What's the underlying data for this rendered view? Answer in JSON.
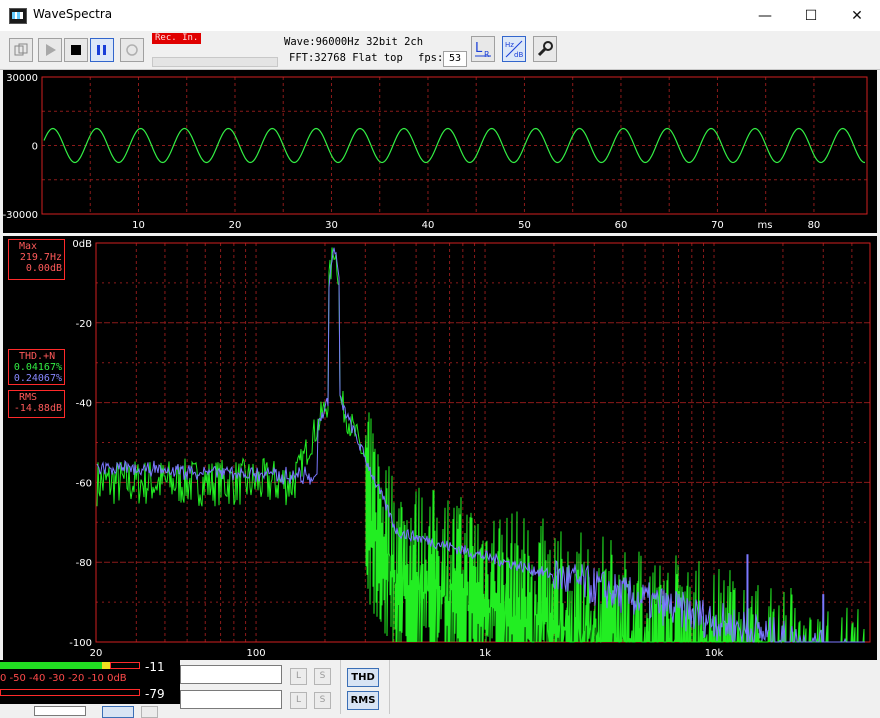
{
  "window": {
    "title": "WaveSpectra",
    "minimize": "—",
    "maximize": "☐",
    "close": "✕"
  },
  "toolbar": {
    "rec_badge": "Rec. In.",
    "wave_label": "Wave:",
    "wave_value": "96000Hz 32bit 2ch",
    "fft_label": "FFT:",
    "fft_value": "32768 Flat top",
    "fps_label": "fps:",
    "fps_value": "53",
    "buttons": [
      "open",
      "play",
      "stop",
      "pause",
      "record"
    ],
    "lr_button": "L R",
    "hz_db_button": "Hz dB",
    "settings_icon": "wrench-icon"
  },
  "wave_panel": {
    "y_ticks": [
      "30000",
      "0",
      "-30000"
    ],
    "x_ticks": [
      "10",
      "20",
      "30",
      "40",
      "50",
      "60",
      "70",
      "80"
    ],
    "x_unit": "ms"
  },
  "spectrum_panel": {
    "y_ticks": [
      "0dB",
      "-20",
      "-40",
      "-60",
      "-80",
      "-100"
    ],
    "x_ticks": [
      "20",
      "100",
      "1k",
      "10k"
    ]
  },
  "measurements": {
    "max_label": "Max",
    "max_freq": "219.7Hz",
    "max_level": "0.00dB",
    "thd_label": "THD.+N",
    "thd_l": "0.04167%",
    "thd_r": "0.24067%",
    "rms_label": "RMS",
    "rms_value": "-14.88dB"
  },
  "level_meter": {
    "scale": "0 -50 -40 -30 -20 -10  0dB",
    "peak_l": "-11",
    "peak_r": "-79"
  },
  "bottom": {
    "l_label": "L",
    "s_label": "S",
    "thd_button": "THD",
    "rms_button": "RMS"
  },
  "colors": {
    "wave": "#33ee44",
    "spectrum_l": "#22ee22",
    "spectrum_r": "#7b78ff",
    "grid": "#8b1a1a",
    "border": "#d02020"
  }
}
